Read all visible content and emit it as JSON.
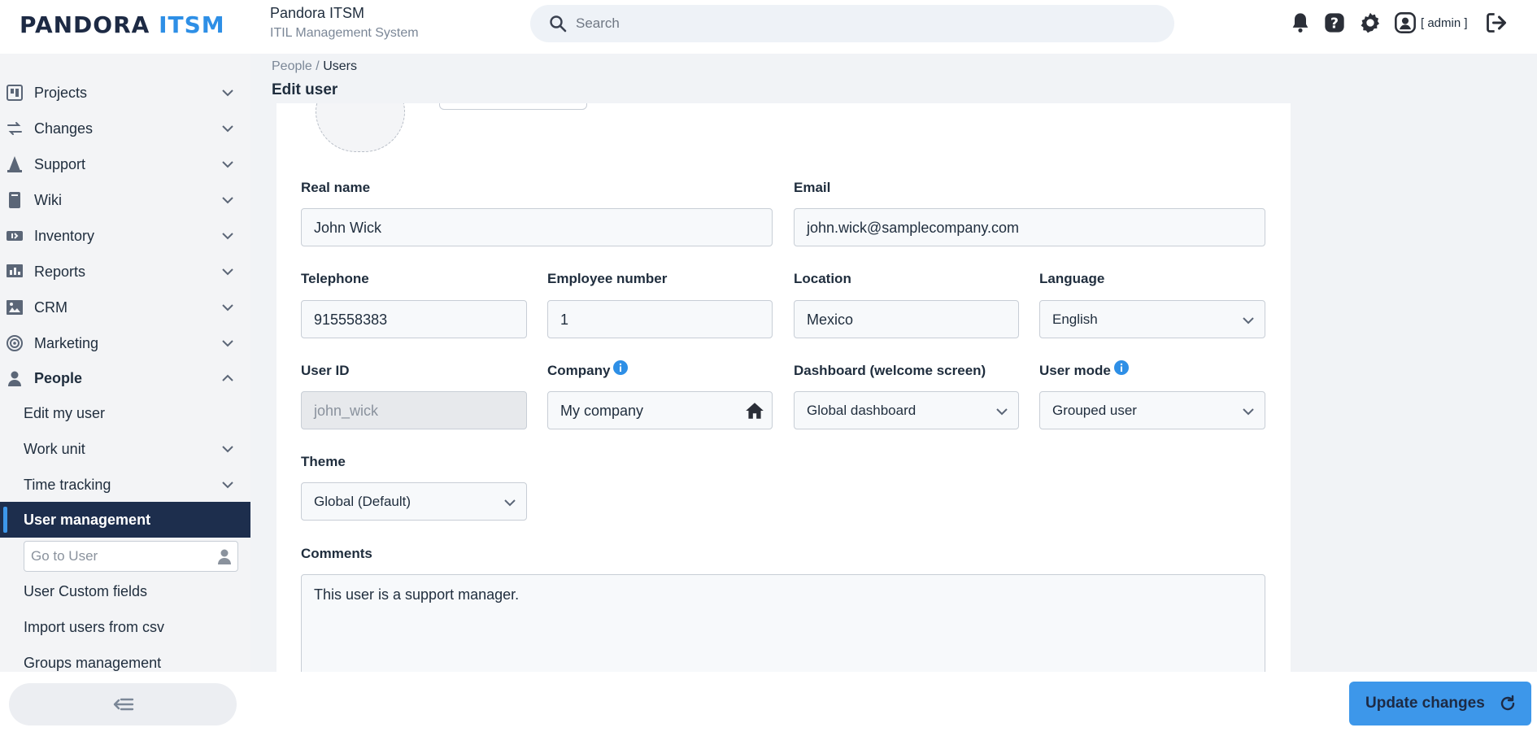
{
  "header": {
    "logo_part1": "PANDORA",
    "logo_part2": "ITSM",
    "app_title": "Pandora ITSM",
    "app_subtitle": "ITIL Management System",
    "search_placeholder": "Search",
    "user_label": "[ admin ]"
  },
  "sidebar": {
    "items": [
      {
        "label": "Projects",
        "icon": "projects-icon"
      },
      {
        "label": "Changes",
        "icon": "changes-icon"
      },
      {
        "label": "Support",
        "icon": "support-icon"
      },
      {
        "label": "Wiki",
        "icon": "wiki-icon"
      },
      {
        "label": "Inventory",
        "icon": "inventory-icon"
      },
      {
        "label": "Reports",
        "icon": "reports-icon"
      },
      {
        "label": "CRM",
        "icon": "crm-icon"
      },
      {
        "label": "Marketing",
        "icon": "marketing-icon"
      },
      {
        "label": "People",
        "icon": "people-icon"
      }
    ],
    "people_sub": {
      "edit_my_user": "Edit my user",
      "work_unit": "Work unit",
      "time_tracking": "Time tracking",
      "user_management": "User management",
      "goto_placeholder": "Go to User",
      "user_custom_fields": "User Custom fields",
      "import_users": "Import users from csv",
      "groups_management": "Groups management"
    }
  },
  "breadcrumb": {
    "parent": "People",
    "sep": "/",
    "current": "Users"
  },
  "page_title": "Edit user",
  "form": {
    "real_name_label": "Real name",
    "real_name": "John Wick",
    "email_label": "Email",
    "email": "john.wick@samplecompany.com",
    "telephone_label": "Telephone",
    "telephone": "915558383",
    "employee_label": "Employee number",
    "employee": "1",
    "location_label": "Location",
    "location": "Mexico",
    "language_label": "Language",
    "language": "English",
    "user_id_label": "User ID",
    "user_id": "john_wick",
    "company_label": "Company",
    "company": "My company",
    "dashboard_label": "Dashboard (welcome screen)",
    "dashboard": "Global dashboard",
    "user_mode_label": "User mode",
    "user_mode": "Grouped user",
    "theme_label": "Theme",
    "theme": "Global (Default)",
    "comments_label": "Comments",
    "comments": "This user is a support manager."
  },
  "footer": {
    "update_label": "Update changes"
  },
  "colors": {
    "accent": "#3d97ea",
    "nav_active": "#1d2e4d"
  }
}
